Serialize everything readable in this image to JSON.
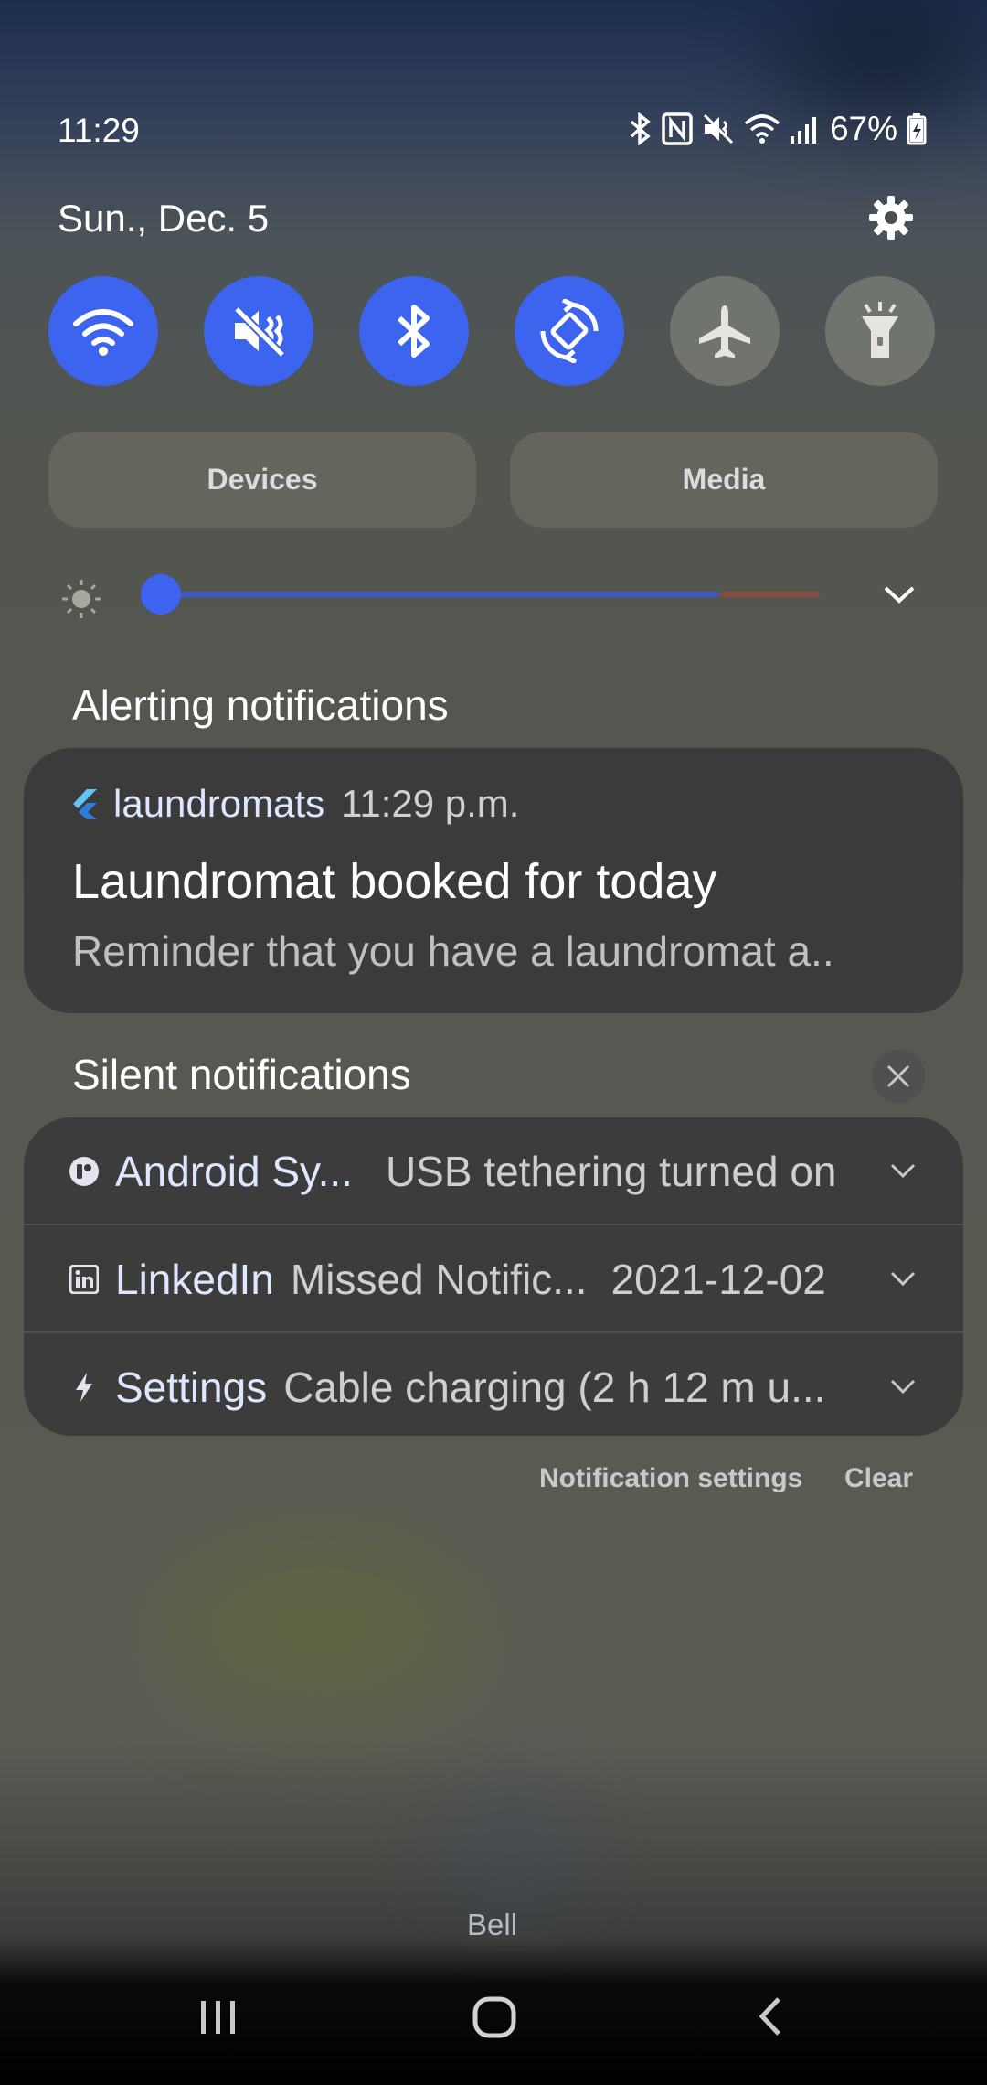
{
  "status_bar": {
    "time": "11:29",
    "battery": "67%",
    "icons": [
      "bluetooth-icon",
      "nfc-icon",
      "mute-icon",
      "wifi-icon",
      "signal-icon",
      "battery-charging-icon"
    ]
  },
  "panel": {
    "date": "Sun., Dec. 5",
    "settings_icon": "gear-icon"
  },
  "quick_settings": [
    {
      "name": "wifi-icon",
      "state": "on"
    },
    {
      "name": "mute-icon",
      "state": "on"
    },
    {
      "name": "bluetooth-icon",
      "state": "on"
    },
    {
      "name": "auto-rotate-icon",
      "state": "on"
    },
    {
      "name": "airplane-icon",
      "state": "off"
    },
    {
      "name": "flashlight-icon",
      "state": "off"
    }
  ],
  "buttons": {
    "devices": "Devices",
    "media": "Media"
  },
  "brightness": {
    "level": 0.0
  },
  "alerting": {
    "title": "Alerting notifications",
    "notification": {
      "app": "laundromats",
      "time": "11:29 p.m.",
      "title": "Laundromat booked for today",
      "body": "Reminder that you have a laundromat a.."
    }
  },
  "silent": {
    "title": "Silent notifications",
    "items": [
      {
        "icon": "android-system-icon",
        "app": "Android Sy...",
        "text": "USB tethering turned on",
        "date": ""
      },
      {
        "icon": "linkedin-icon",
        "app": "LinkedIn",
        "text": "Missed Notific...",
        "date": "2021-12-02"
      },
      {
        "icon": "lightning-icon",
        "app": "Settings",
        "text": "Cable charging (2 h 12 m u...",
        "date": ""
      }
    ]
  },
  "footer": {
    "notification_settings": "Notification settings",
    "clear": "Clear"
  },
  "background_label": "Bell",
  "colors": {
    "accent": "#3c64ee",
    "card": "#383838"
  }
}
